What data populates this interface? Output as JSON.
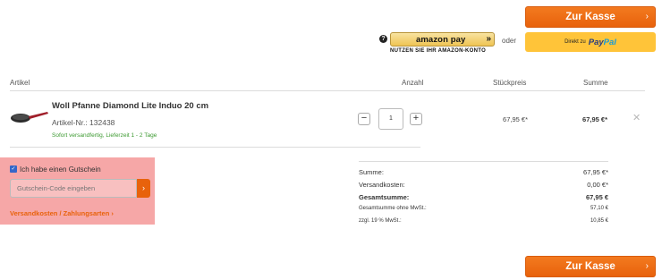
{
  "checkout": {
    "label": "Zur Kasse",
    "chevron": "›"
  },
  "amazon": {
    "help_icon": "?",
    "pay_text": "amazon pay",
    "chevron": "»",
    "subtitle": "NUTZEN SIE IHR AMAZON-KONTO"
  },
  "oder": "oder",
  "paypal": {
    "direkt": "Direkt zu",
    "pay": "Pay",
    "pal": "Pal"
  },
  "table": {
    "headers": {
      "article": "Artikel",
      "quantity": "Anzahl",
      "unit_price": "Stückpreis",
      "total": "Summe"
    }
  },
  "product": {
    "name": "Woll Pfanne Diamond Lite Induo 20 cm",
    "number": "Artikel-Nr.: 132438",
    "shipping": "Sofort versandfertig, Lieferzeit 1 - 2 Tage",
    "quantity": "1",
    "minus": "−",
    "plus": "+",
    "unit_price": "67,95 €*",
    "total": "67,95 €*",
    "remove": "✕"
  },
  "voucher": {
    "checkbox": "✓",
    "label": "Ich habe einen Gutschein",
    "placeholder": "Gutschein-Code eingeben",
    "submit": "›",
    "shipping_link": "Versandkosten / Zahlungsarten ›"
  },
  "summary": [
    {
      "label": "Summe:",
      "value": "67,95 €*"
    },
    {
      "label": "Versandkosten:",
      "value": "0,00 €*"
    },
    {
      "label": "Gesamtsumme:",
      "value": "67,95 €"
    },
    {
      "label": "Gesamtsumme ohne MwSt.:",
      "value": "57,10 €"
    },
    {
      "label": "zzgl. 19 % MwSt.:",
      "value": "10,85 €"
    }
  ]
}
